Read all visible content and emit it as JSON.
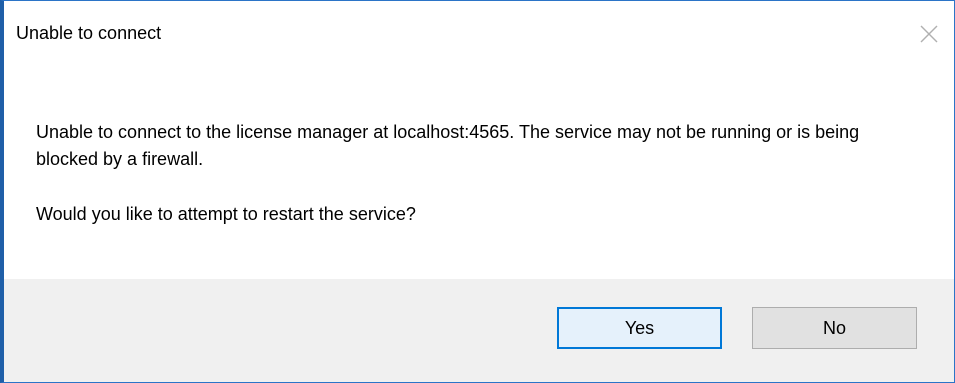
{
  "dialog": {
    "title": "Unable to connect",
    "message": "Unable to connect to the license manager at localhost:4565. The service may not be running or is being blocked by a firewall.",
    "question": "Would you like to attempt to restart the service?",
    "buttons": {
      "yes_label": "Yes",
      "no_label": "No"
    },
    "close_icon": "close-icon",
    "colors": {
      "accent": "#0078d7",
      "footer_bg": "#f0f0f0",
      "button_bg": "#e1e1e1",
      "border": "#2b74c7"
    }
  }
}
